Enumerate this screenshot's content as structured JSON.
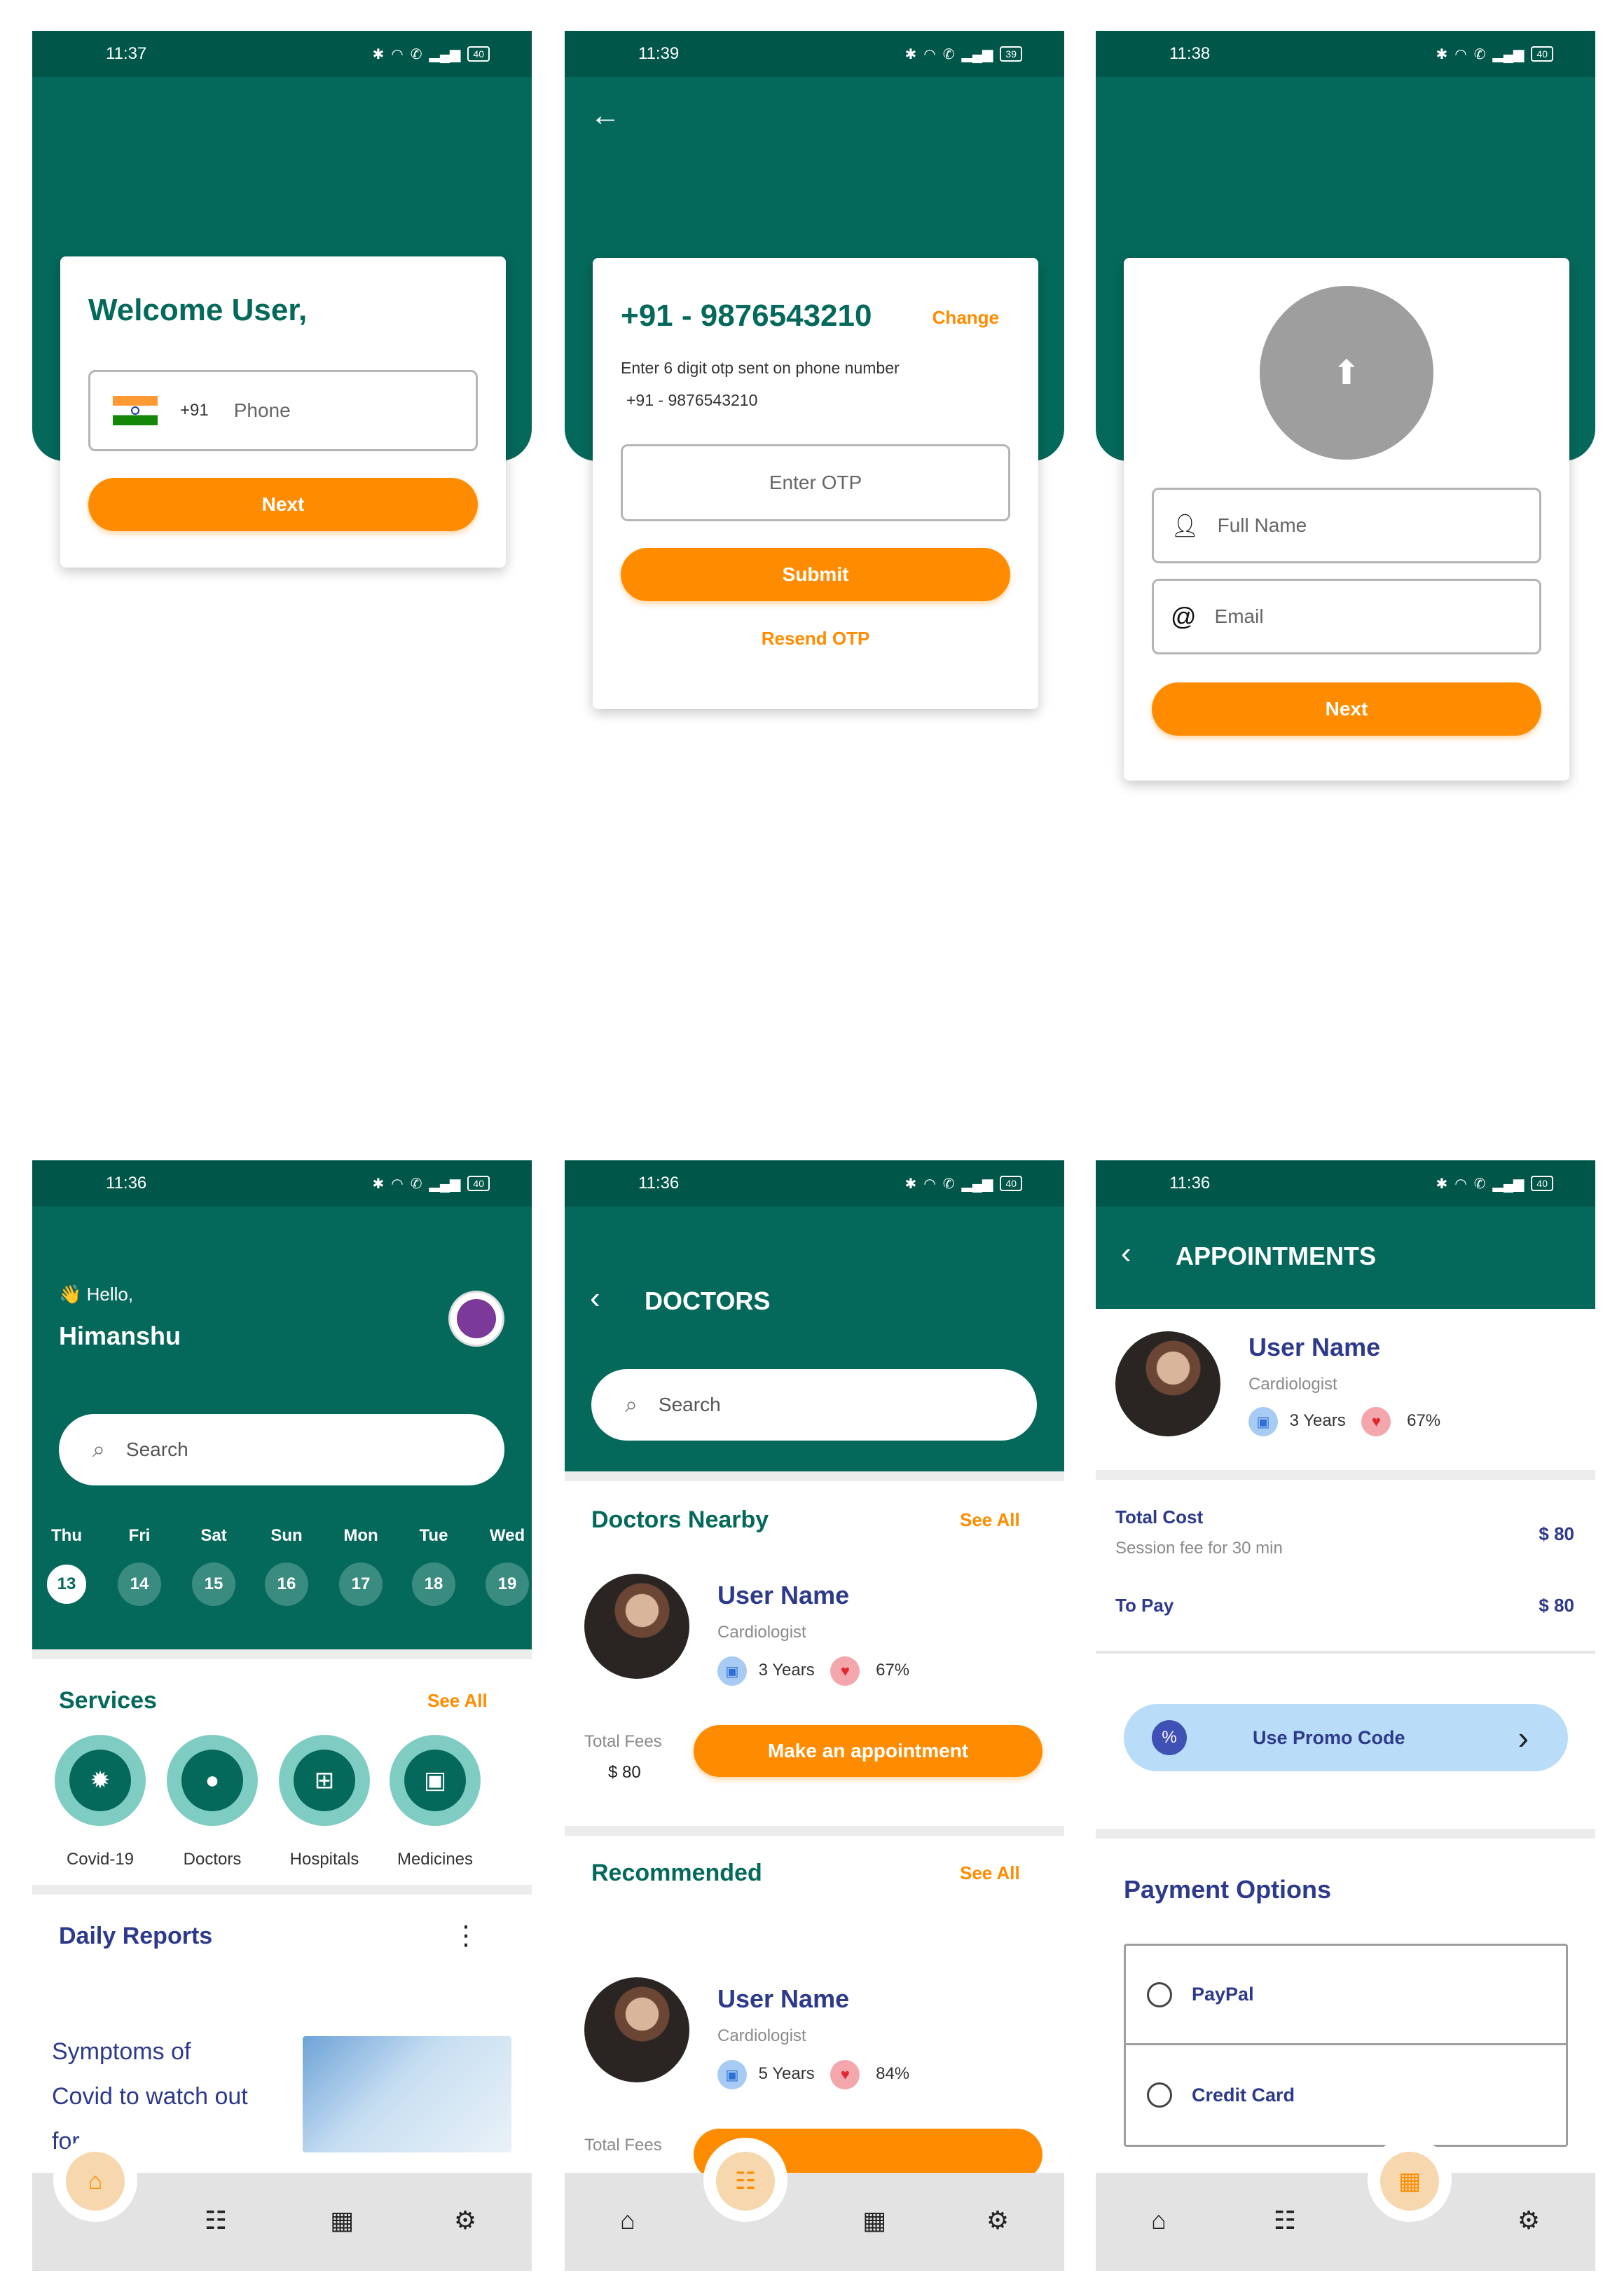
{
  "colors": {
    "primary": "#04695b",
    "accent": "#ff8c00",
    "navy": "#2d3a8c"
  },
  "screens": {
    "welcome": {
      "time": "11:37",
      "battery": "40",
      "title": "Welcome User,",
      "country_code": "+91",
      "phone_placeholder": "Phone",
      "next": "Next"
    },
    "otp": {
      "time": "11:39",
      "battery": "39",
      "phone": "+91 - 9876543210",
      "change": "Change",
      "desc": "Enter 6 digit otp sent on phone number",
      "desc_phone": "+91 - 9876543210",
      "otp_placeholder": "Enter OTP",
      "submit": "Submit",
      "resend": "Resend OTP"
    },
    "profile": {
      "time": "11:38",
      "battery": "40",
      "name_placeholder": "Full Name",
      "email_placeholder": "Email",
      "next": "Next"
    },
    "home": {
      "time": "11:36",
      "battery": "40",
      "hello": "Hello,",
      "username": "Himanshu",
      "search_placeholder": "Search",
      "days": [
        {
          "d": "Thu",
          "n": "13"
        },
        {
          "d": "Fri",
          "n": "14"
        },
        {
          "d": "Sat",
          "n": "15"
        },
        {
          "d": "Sun",
          "n": "16"
        },
        {
          "d": "Mon",
          "n": "17"
        },
        {
          "d": "Tue",
          "n": "18"
        },
        {
          "d": "Wed",
          "n": "19"
        }
      ],
      "services_title": "Services",
      "see_all": "See All",
      "services": [
        "Covid-19",
        "Doctors",
        "Hospitals",
        "Medicines"
      ],
      "daily_reports": "Daily Reports",
      "article_line1": "Symptoms of",
      "article_line2": "Covid to watch out",
      "article_line3": "for."
    },
    "doctors": {
      "time": "11:36",
      "battery": "40",
      "title": "DOCTORS",
      "search_placeholder": "Search",
      "nearby_title": "Doctors Nearby",
      "see_all": "See All",
      "doc1": {
        "name": "User Name",
        "specialty": "Cardiologist",
        "years": "3 Years",
        "rating": "67%"
      },
      "total_fees_label": "Total Fees",
      "total_fees": "$ 80",
      "appointment_btn": "Make an appointment",
      "recommended_title": "Recommended",
      "doc2": {
        "name": "User Name",
        "specialty": "Cardiologist",
        "years": "5 Years",
        "rating": "84%"
      },
      "partial_fees": "Total Fees"
    },
    "appointments": {
      "time": "11:36",
      "battery": "40",
      "title": "APPOINTMENTS",
      "doc": {
        "name": "User Name",
        "specialty": "Cardiologist",
        "years": "3 Years",
        "rating": "67%"
      },
      "total_cost": "Total Cost",
      "session": "Session fee for 30 min",
      "cost": "$ 80",
      "to_pay": "To Pay",
      "pay": "$ 80",
      "promo": "Use Promo Code",
      "payment_options": "Payment Options",
      "options": [
        "PayPal",
        "Credit Card"
      ]
    }
  }
}
